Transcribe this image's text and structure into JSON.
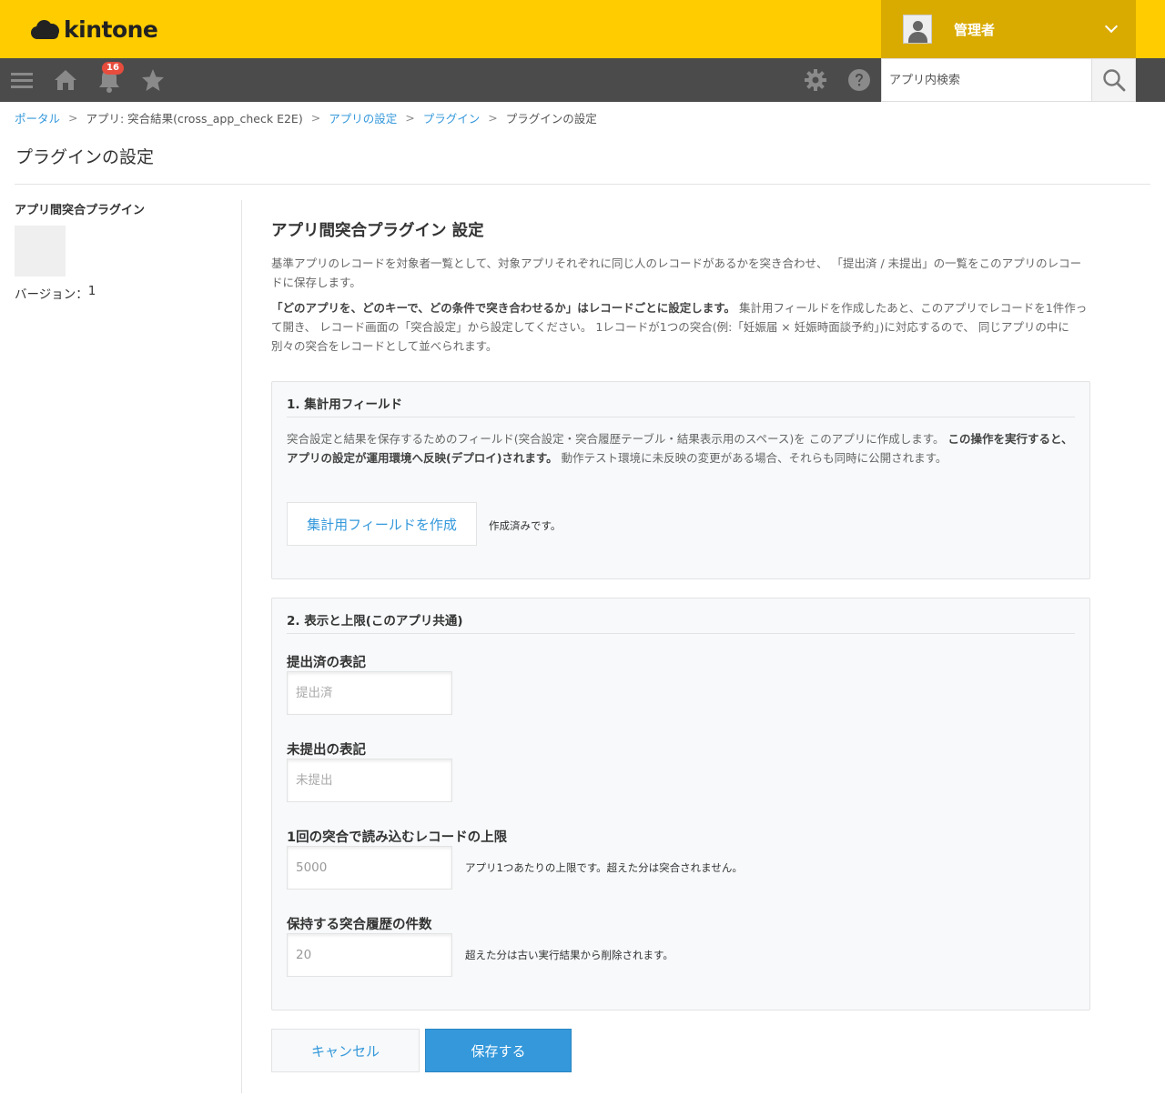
{
  "header": {
    "logo_text": "kintone",
    "user_name": "管理者",
    "notification_count": "16",
    "search_placeholder": "アプリ内検索"
  },
  "breadcrumb": [
    {
      "label": "ポータル",
      "link": true
    },
    {
      "label": "アプリ: 突合結果(cross_app_check E2E)",
      "link": true
    },
    {
      "label": "アプリの設定",
      "link": true
    },
    {
      "label": "プラグイン",
      "link": true
    },
    {
      "label": "プラグインの設定",
      "link": false
    }
  ],
  "breadcrumb_separator": ">",
  "page_title": "プラグインの設定",
  "sidebar": {
    "plugin_name": "アプリ間突合プラグイン",
    "version_label": "バージョン：",
    "version_value": "1"
  },
  "main": {
    "heading": "アプリ間突合プラグイン 設定",
    "description_1": "基準アプリのレコードを対象者一覧として、対象アプリそれぞれに同じ人のレコードがあるかを突き合わせ、 「提出済 / 未提出」の一覧をこのアプリのレコードに保存します。",
    "description_2_bold": "「どのアプリを、どのキーで、どの条件で突き合わせるか」はレコードごとに設定します。",
    "description_2_rest": " 集計用フィールドを作成したあと、このアプリでレコードを1件作って開き、 レコード画面の「突合設定」から設定してください。 1レコードが1つの突合(例:「妊娠届 × 妊娠時面談予約」)に対応するので、 同じアプリの中に別々の突合をレコードとして並べられます。"
  },
  "section1": {
    "title": "1. 集計用フィールド",
    "desc_plain_1": "突合設定と結果を保存するためのフィールド(突合設定・突合履歴テーブル・結果表示用のスペース)を このアプリに作成します。 ",
    "desc_bold": "この操作を実行すると、アプリの設定が運用環境へ反映(デプロイ)されます。",
    "desc_plain_2": " 動作テスト環境に未反映の変更がある場合、それらも同時に公開されます。",
    "create_button": "集計用フィールドを作成",
    "status": "作成済みです。"
  },
  "section2": {
    "title": "2. 表示と上限(このアプリ共通)",
    "fields": [
      {
        "label": "提出済の表記",
        "placeholder": "提出済",
        "value": "",
        "hint": ""
      },
      {
        "label": "未提出の表記",
        "placeholder": "未提出",
        "value": "",
        "hint": ""
      },
      {
        "label": "1回の突合で読み込むレコードの上限",
        "placeholder": "",
        "value": "5000",
        "hint": "アプリ1つあたりの上限です。超えた分は突合されません。"
      },
      {
        "label": "保持する突合履歴の件数",
        "placeholder": "",
        "value": "20",
        "hint": "超えた分は古い実行結果から削除されます。"
      }
    ]
  },
  "actions": {
    "cancel": "キャンセル",
    "save": "保存する"
  },
  "colors": {
    "header_yellow": "#ffcc00",
    "user_area": "#d9ab00",
    "navbar": "#4b4b4b",
    "accent_blue": "#3498db",
    "badge_red": "#e74c3c"
  }
}
